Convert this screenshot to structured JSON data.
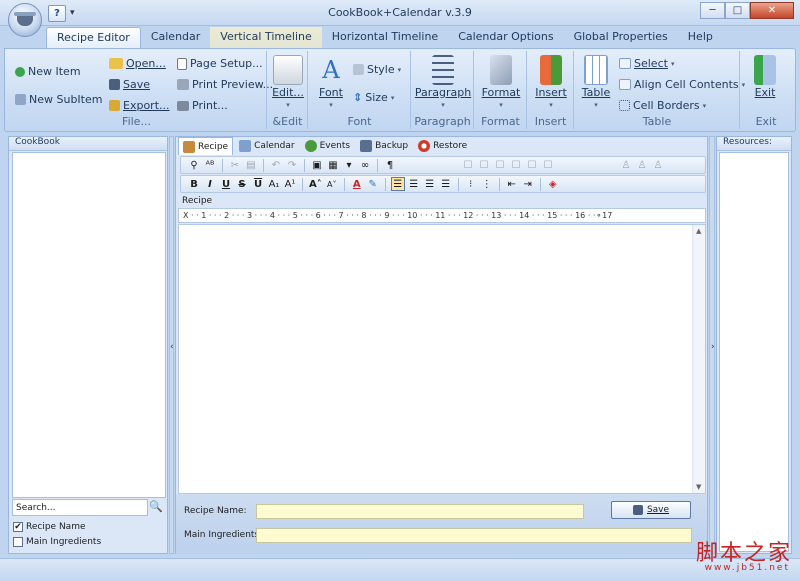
{
  "window": {
    "title": "CookBook+Calendar v.3.9"
  },
  "qat": {
    "help_glyph": "?",
    "arrow_glyph": "▾"
  },
  "window_buttons": {
    "minimize": "─",
    "maximize": "□",
    "close": "✕"
  },
  "tabs": [
    "Recipe Editor",
    "Calendar",
    "Vertical Timeline",
    "Horizontal Timeline",
    "Calendar Options",
    "Global Properties",
    "Help"
  ],
  "ribbon": {
    "file": {
      "new_item": "New Item",
      "new_subitem": "New SubItem",
      "open": "Open...",
      "save": "Save",
      "export": "Export...",
      "page_setup": "Page Setup...",
      "print_preview": "Print Preview...",
      "print": "Print...",
      "label": "File..."
    },
    "edit": {
      "edit": "Edit...",
      "label": "&Edit"
    },
    "font": {
      "font": "Font",
      "style": "Style",
      "size": "Size",
      "label": "Font"
    },
    "paragraph": {
      "paragraph": "Paragraph",
      "label": "Paragraph"
    },
    "format": {
      "format": "Format",
      "label": "Format"
    },
    "insert": {
      "insert": "Insert",
      "label": "Insert"
    },
    "table": {
      "table": "Table",
      "select": "Select",
      "align": "Align Cell Contents",
      "borders": "Cell Borders",
      "label": "Table"
    },
    "exit": {
      "exit": "Exit",
      "label": "Exit"
    }
  },
  "left_panel": {
    "title": "CookBook",
    "search_value": "Search...",
    "recipe_name": "Recipe Name",
    "main_ingredients": "Main Ingredients",
    "recipe_name_checked": "✔"
  },
  "editor_tabs": [
    "Recipe",
    "Calendar",
    "Events",
    "Backup",
    "Restore"
  ],
  "editor": {
    "recipe_label": "Recipe",
    "ruler": "Ⅹ · · 1 · · · 2 · · · 3 · · · 4 · · · 5 · · · 6 · · · 7 · · · 8 · · · 9 · · · 10 · · · 11 · · · 12 · · · 13 · · · 14 · · · 15 · · · 16 · ·⚬17"
  },
  "form": {
    "recipe_name_label": "Recipe Name:",
    "main_ingredients_label": "Main Ingredients:",
    "save_button": "Save"
  },
  "right_panel": {
    "title": "Resources:"
  },
  "watermark": {
    "text": "脚本之家",
    "url": "www.jb51.net"
  },
  "colors": {
    "accent": "#1f4e9a",
    "ribbon_bg": "#c9dcf3",
    "input_yellow": "#fefbd0",
    "watermark": "#c42424"
  }
}
